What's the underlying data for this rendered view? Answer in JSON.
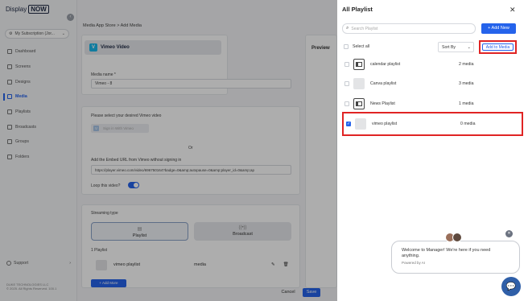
{
  "brand": {
    "name": "Display",
    "badge": "NOW"
  },
  "sidebar": {
    "subscription": "My Subscription (Jor...",
    "items": [
      {
        "label": "Dashboard",
        "icon": "dashboard-icon"
      },
      {
        "label": "Screens",
        "icon": "screen-icon"
      },
      {
        "label": "Designs",
        "icon": "design-icon"
      },
      {
        "label": "Media",
        "icon": "media-icon",
        "active": true
      },
      {
        "label": "Playlists",
        "icon": "playlist-icon"
      },
      {
        "label": "Broadcasts",
        "icon": "broadcast-icon"
      },
      {
        "label": "Groups",
        "icon": "group-icon"
      },
      {
        "label": "Folders",
        "icon": "folder-icon"
      }
    ],
    "support": "Support",
    "company": "DUKE TECHNOLOGIES LLC",
    "copyright": "© 2025. All Rights Reserved. 100.1"
  },
  "main": {
    "breadcrumb": "Media App Store  >  Add Media",
    "header": "Vimeo Video",
    "preview": "Preview",
    "media_name_label": "Media name *",
    "media_name_value": "Vimeo - 8",
    "select_video_label": "Please select your desired Vimeo video",
    "sign_in": "Sign in With Vimeo",
    "or": "Or",
    "embed_label": "Add the Embed URL from Vimeo without signing in",
    "embed_value": "https://player.vimeo.com/video/696750164?badge=0&amp;autopause=0&amp;player_id=0&amp;ap",
    "loop_label": "Loop this video?",
    "loop_on": true,
    "streaming_label": "Streaming type",
    "stream_playlist": "Playlist",
    "stream_broadcast": "Broadcast",
    "playlist_count": "1 Playlist",
    "playlist_row": {
      "name": "vimeo playlist",
      "type": "media"
    },
    "add_more": "+ Add More",
    "cancel": "Cancel",
    "save": "Save"
  },
  "panel": {
    "title": "All Playlist",
    "search_placeholder": "Search Playlist",
    "add_new": "+ Add New",
    "select_all": "Select all",
    "sort_by": "Sort By",
    "add_to_media": "Add to Media",
    "playlists": [
      {
        "name": "calendar playlist",
        "count": "2 media",
        "thumb": "grid",
        "checked": false
      },
      {
        "name": "Canva playlist",
        "count": "3 media",
        "thumb": "gray",
        "checked": false
      },
      {
        "name": "News Playlist",
        "count": "1 media",
        "thumb": "grid",
        "checked": false
      },
      {
        "name": "vimeo playlist",
        "count": "0 media",
        "thumb": "gray",
        "checked": true
      }
    ]
  },
  "chat": {
    "message": "Welcome to Manager! We're here if you need anything.",
    "powered": "Powered by AI"
  },
  "colors": {
    "accent": "#2563eb",
    "highlight": "#e02424"
  }
}
